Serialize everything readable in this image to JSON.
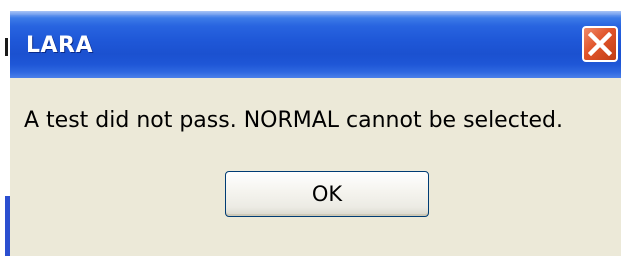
{
  "dialog": {
    "title": "LARA",
    "message": "A test did not pass. NORMAL cannot be selected.",
    "ok_label": "OK"
  },
  "icons": {
    "close": "close-icon"
  },
  "colors": {
    "titlebar_blue": "#1f58d8",
    "close_red": "#e0542a",
    "dialog_background": "#ece9d8"
  }
}
